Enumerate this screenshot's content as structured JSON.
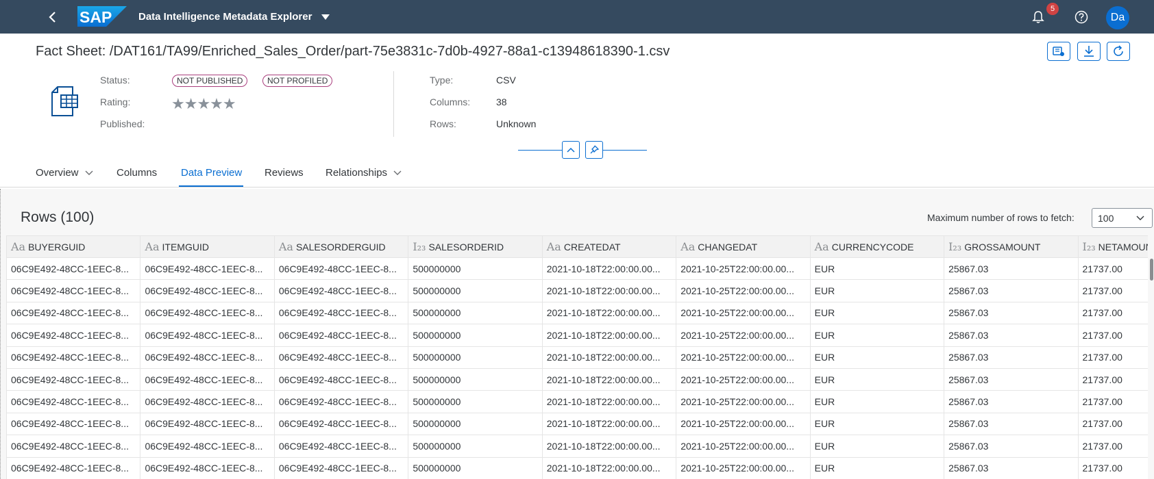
{
  "shell": {
    "logo_text": "SAP",
    "app_title": "Data Intelligence Metadata Explorer",
    "notification_count": "5",
    "avatar_initials": "Da"
  },
  "header": {
    "title": "Fact Sheet: /DAT161/TA99/Enriched_Sales_Order/part-75e3831c-7d0b-4927-88a1-c13948618390-1.csv",
    "status_label": "Status:",
    "status_badges": [
      "NOT PUBLISHED",
      "NOT PROFILED"
    ],
    "rating_label": "Rating:",
    "rating_stars": "★★★★★",
    "rating_value": 0,
    "published_label": "Published:",
    "type_label": "Type:",
    "type_value": "CSV",
    "columns_label": "Columns:",
    "columns_value": "38",
    "rows_label": "Rows:",
    "rows_value": "Unknown"
  },
  "tabs": [
    {
      "label": "Overview",
      "has_dropdown": true
    },
    {
      "label": "Columns",
      "has_dropdown": false
    },
    {
      "label": "Data Preview",
      "has_dropdown": false,
      "active": true
    },
    {
      "label": "Reviews",
      "has_dropdown": false
    },
    {
      "label": "Relationships",
      "has_dropdown": true
    }
  ],
  "preview": {
    "title": "Rows (100)",
    "fetch_label": "Maximum number of rows to fetch:",
    "fetch_value": "100",
    "columns": [
      {
        "type_icon": "Aa",
        "name": "BUYERGUID"
      },
      {
        "type_icon": "Aa",
        "name": "ITEMGUID"
      },
      {
        "type_icon": "Aa",
        "name": "SALESORDERGUID"
      },
      {
        "type_icon": "I₂₃",
        "name": "SALESORDERID"
      },
      {
        "type_icon": "Aa",
        "name": "CREATEDAT"
      },
      {
        "type_icon": "Aa",
        "name": "CHANGEDAT"
      },
      {
        "type_icon": "Aa",
        "name": "CURRENCYCODE"
      },
      {
        "type_icon": "I₂₃",
        "name": "GROSSAMOUNT"
      },
      {
        "type_icon": "I₂₃",
        "name": "NETAMOUNT"
      }
    ],
    "rows": [
      [
        "06C9E492-48CC-1EEC-8...",
        "06C9E492-48CC-1EEC-8...",
        "06C9E492-48CC-1EEC-8...",
        "500000000",
        "2021-10-18T22:00:00.00...",
        "2021-10-25T22:00:00.00...",
        "EUR",
        "25867.03",
        "21737.00"
      ],
      [
        "06C9E492-48CC-1EEC-8...",
        "06C9E492-48CC-1EEC-8...",
        "06C9E492-48CC-1EEC-8...",
        "500000000",
        "2021-10-18T22:00:00.00...",
        "2021-10-25T22:00:00.00...",
        "EUR",
        "25867.03",
        "21737.00"
      ],
      [
        "06C9E492-48CC-1EEC-8...",
        "06C9E492-48CC-1EEC-8...",
        "06C9E492-48CC-1EEC-8...",
        "500000000",
        "2021-10-18T22:00:00.00...",
        "2021-10-25T22:00:00.00...",
        "EUR",
        "25867.03",
        "21737.00"
      ],
      [
        "06C9E492-48CC-1EEC-8...",
        "06C9E492-48CC-1EEC-8...",
        "06C9E492-48CC-1EEC-8...",
        "500000000",
        "2021-10-18T22:00:00.00...",
        "2021-10-25T22:00:00.00...",
        "EUR",
        "25867.03",
        "21737.00"
      ],
      [
        "06C9E492-48CC-1EEC-8...",
        "06C9E492-48CC-1EEC-8...",
        "06C9E492-48CC-1EEC-8...",
        "500000000",
        "2021-10-18T22:00:00.00...",
        "2021-10-25T22:00:00.00...",
        "EUR",
        "25867.03",
        "21737.00"
      ],
      [
        "06C9E492-48CC-1EEC-8...",
        "06C9E492-48CC-1EEC-8...",
        "06C9E492-48CC-1EEC-8...",
        "500000000",
        "2021-10-18T22:00:00.00...",
        "2021-10-25T22:00:00.00...",
        "EUR",
        "25867.03",
        "21737.00"
      ],
      [
        "06C9E492-48CC-1EEC-8...",
        "06C9E492-48CC-1EEC-8...",
        "06C9E492-48CC-1EEC-8...",
        "500000000",
        "2021-10-18T22:00:00.00...",
        "2021-10-25T22:00:00.00...",
        "EUR",
        "25867.03",
        "21737.00"
      ],
      [
        "06C9E492-48CC-1EEC-8...",
        "06C9E492-48CC-1EEC-8...",
        "06C9E492-48CC-1EEC-8...",
        "500000000",
        "2021-10-18T22:00:00.00...",
        "2021-10-25T22:00:00.00...",
        "EUR",
        "25867.03",
        "21737.00"
      ],
      [
        "06C9E492-48CC-1EEC-8...",
        "06C9E492-48CC-1EEC-8...",
        "06C9E492-48CC-1EEC-8...",
        "500000000",
        "2021-10-18T22:00:00.00...",
        "2021-10-25T22:00:00.00...",
        "EUR",
        "25867.03",
        "21737.00"
      ],
      [
        "06C9E492-48CC-1EEC-8...",
        "06C9E492-48CC-1EEC-8...",
        "06C9E492-48CC-1EEC-8...",
        "500000000",
        "2021-10-18T22:00:00.00...",
        "2021-10-25T22:00:00.00...",
        "EUR",
        "25867.03",
        "21737.00"
      ]
    ]
  },
  "icons": {
    "back": "chevron-left-icon",
    "title_menu": "caret-down-icon",
    "notifications": "bell-icon",
    "help": "help-icon",
    "add_to_catalog": "catalog-icon",
    "download": "download-icon",
    "refresh": "refresh-icon",
    "dataset": "table-file-icon",
    "collapse": "chevron-up-icon",
    "pin": "pin-icon"
  },
  "colors": {
    "shell_bg": "#354a5f",
    "accent": "#0a6ed1",
    "badge_border": "#a93e7d",
    "notification": "#d04343"
  }
}
